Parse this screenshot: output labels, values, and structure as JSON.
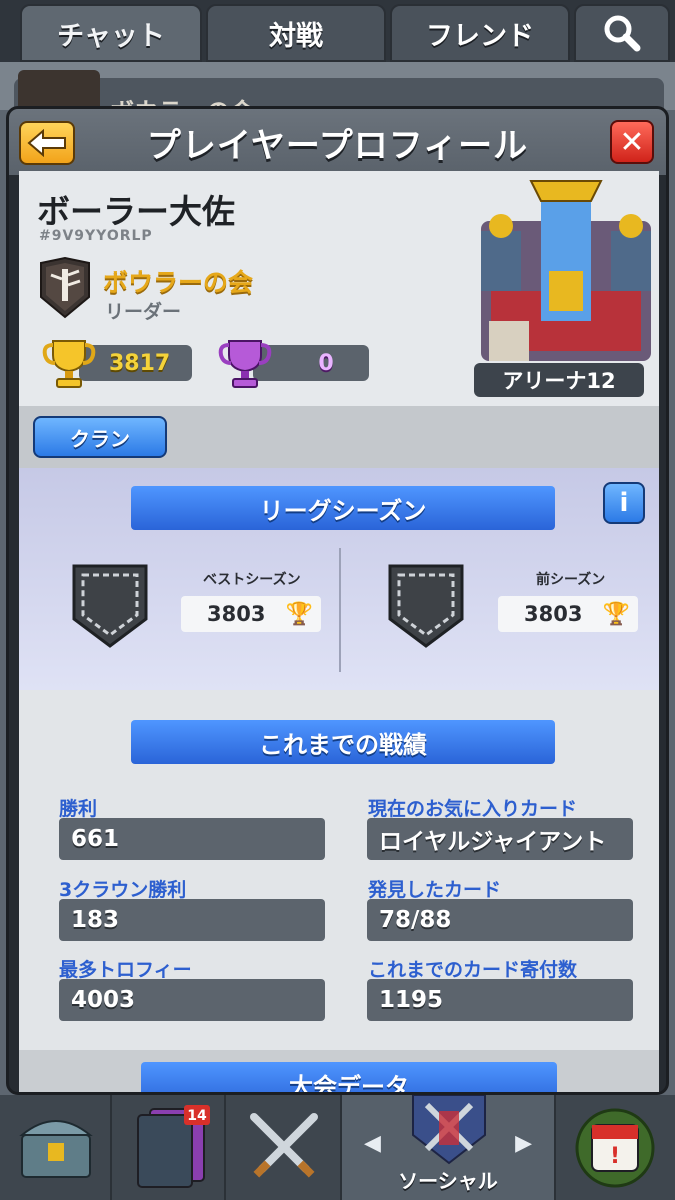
{
  "tabs": [
    {
      "label": "チャット",
      "active": true
    },
    {
      "label": "対戦",
      "active": false
    },
    {
      "label": "フレンド",
      "active": false
    }
  ],
  "background_row": {
    "clan_name_partial": "ボウラーの会"
  },
  "modal": {
    "title": "プレイヤープロフィール"
  },
  "profile": {
    "name": "ボーラー大佐",
    "tag": "#9V9YYORLP",
    "clan_name": "ボウラーの会",
    "clan_role": "リーダー",
    "trophies": "3817",
    "challenge_trophies": "0",
    "arena": "アリーナ12"
  },
  "clan_button": "クラン",
  "league": {
    "title": "リーグシーズン",
    "info_label": "i",
    "best_season_label": "ベストシーズン",
    "best_season_value": "3803",
    "previous_season_label": "前シーズン",
    "previous_season_value": "3803"
  },
  "records": {
    "title": "これまでの戦績",
    "items": [
      {
        "label": "勝利",
        "value": "661"
      },
      {
        "label": "現在のお気に入りカード",
        "value": "ロイヤルジャイアント"
      },
      {
        "label": "3クラウン勝利",
        "value": "183"
      },
      {
        "label": "発見したカード",
        "value": "78/88"
      },
      {
        "label": "最多トロフィー",
        "value": "4003"
      },
      {
        "label": "これまでのカード寄付数",
        "value": "1195"
      }
    ]
  },
  "tournament": {
    "title": "大会データ"
  },
  "bottom_nav": {
    "social_label": "ソーシャル",
    "cards_badge": "14"
  },
  "colors": {
    "accent_blue": "#2c7ae6",
    "gold": "#e6a81a",
    "label_blue": "#2d5fcf"
  }
}
